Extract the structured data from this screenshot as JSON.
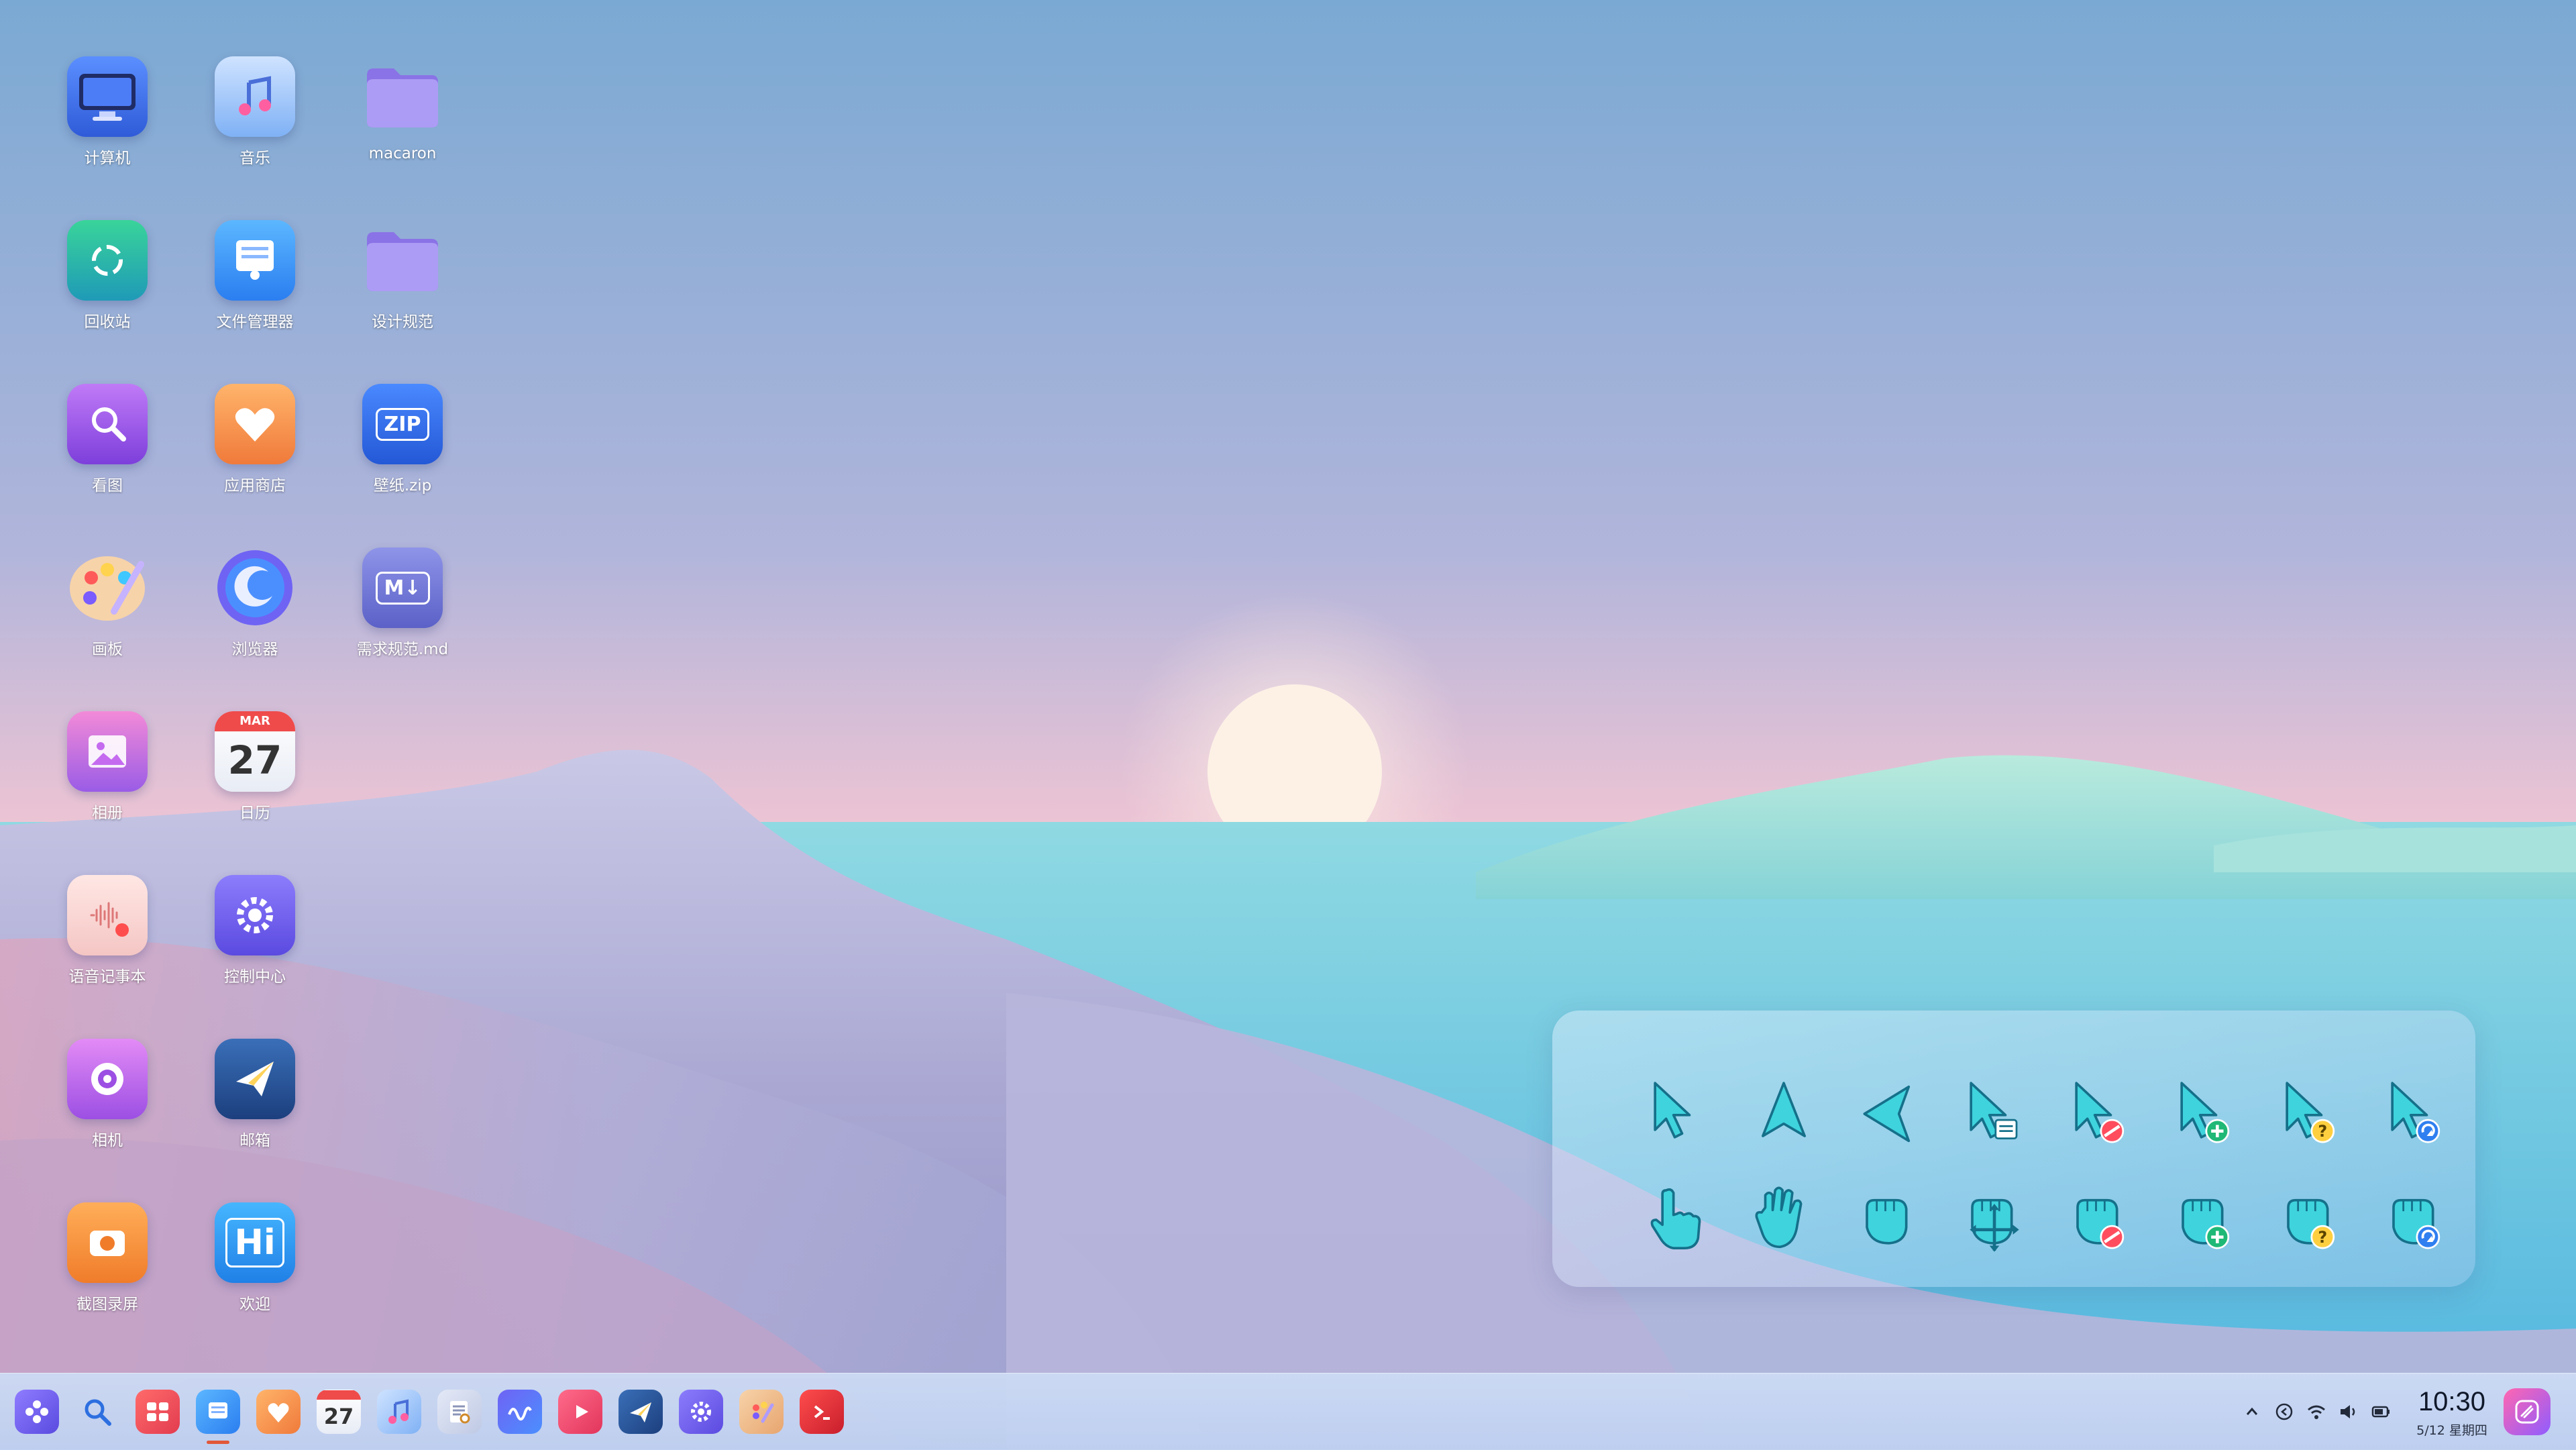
{
  "desktop": {
    "icons": [
      {
        "label": "计算机",
        "icon": "computer-icon"
      },
      {
        "label": "音乐",
        "icon": "music-icon"
      },
      {
        "label": "macaron",
        "icon": "folder-icon"
      },
      {
        "label": "回收站",
        "icon": "trash-icon"
      },
      {
        "label": "文件管理器",
        "icon": "file-manager-icon"
      },
      {
        "label": "设计规范",
        "icon": "folder-icon"
      },
      {
        "label": "看图",
        "icon": "image-viewer-icon"
      },
      {
        "label": "应用商店",
        "icon": "app-store-icon"
      },
      {
        "label": "壁纸.zip",
        "icon": "zip-file-icon",
        "badge": "ZIP"
      },
      {
        "label": "画板",
        "icon": "palette-icon"
      },
      {
        "label": "浏览器",
        "icon": "browser-icon"
      },
      {
        "label": "需求规范.md",
        "icon": "markdown-file-icon",
        "badge": "M↓"
      },
      {
        "label": "相册",
        "icon": "album-icon"
      },
      {
        "label": "日历",
        "icon": "calendar-icon",
        "month": "MAR",
        "day": "27"
      },
      {
        "label": "语音记事本",
        "icon": "voice-notes-icon"
      },
      {
        "label": "控制中心",
        "icon": "control-center-icon"
      },
      {
        "label": "相机",
        "icon": "camera-icon"
      },
      {
        "label": "邮箱",
        "icon": "mail-icon"
      },
      {
        "label": "截图录屏",
        "icon": "screenshot-icon"
      },
      {
        "label": "欢迎",
        "icon": "welcome-icon",
        "badge": "Hi"
      }
    ]
  },
  "cursor_panel": {
    "row1": [
      "arrow-cursor-icon",
      "arrow-up-cursor-icon",
      "arrow-left-cursor-icon",
      "arrow-context-cursor-icon",
      "arrow-forbidden-cursor-icon",
      "arrow-copy-cursor-icon",
      "arrow-help-cursor-icon",
      "arrow-busy-cursor-icon"
    ],
    "row2": [
      "pointer-hand-cursor-icon",
      "open-hand-cursor-icon",
      "grab-hand-cursor-icon",
      "move-hand-cursor-icon",
      "hand-forbidden-cursor-icon",
      "hand-copy-cursor-icon",
      "hand-help-cursor-icon",
      "hand-busy-cursor-icon"
    ]
  },
  "taskbar": {
    "apps": [
      "launcher-icon",
      "search-icon",
      "multitask-icon",
      "file-manager-icon",
      "app-store-icon",
      "calendar-icon",
      "music-icon",
      "document-viewer-icon",
      "browser-icon",
      "video-icon",
      "mail-icon",
      "settings-icon",
      "palette-icon",
      "terminal-icon"
    ],
    "calendar_day": "27",
    "tray": [
      "chevron-up-icon",
      "clipboard-icon",
      "wifi-icon",
      "volume-icon",
      "battery-icon"
    ],
    "clock_time": "10:30",
    "clock_date": "5/12 星期四",
    "colors": {
      "accent": "#e2573a",
      "folder": "#9b87ec",
      "cursor_teal": "#3fd3dd"
    }
  }
}
